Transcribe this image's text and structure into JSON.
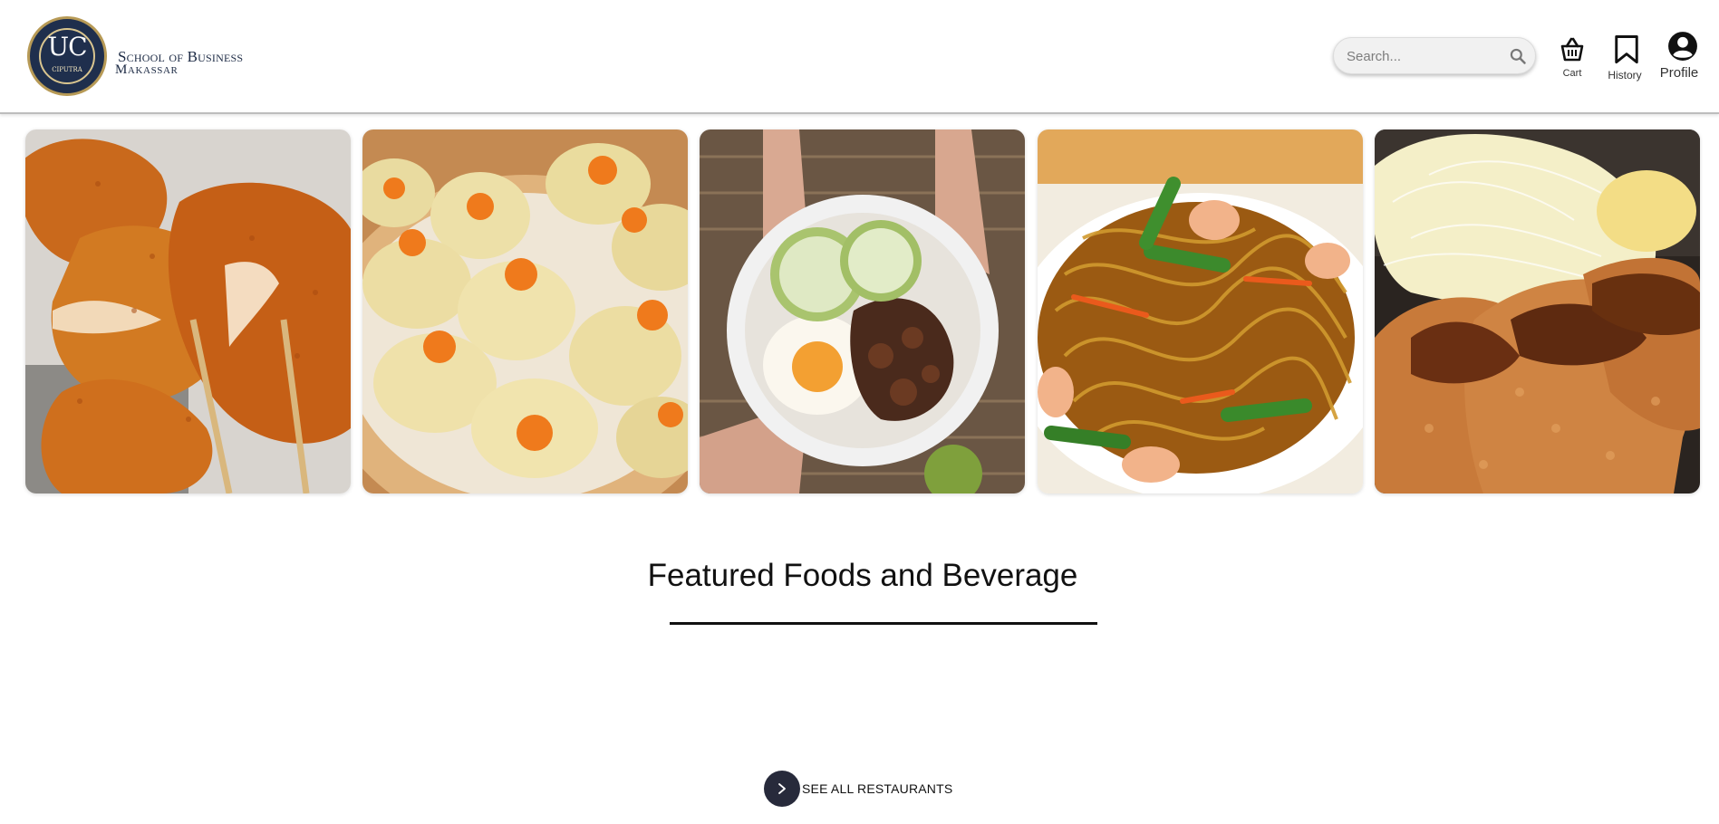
{
  "header": {
    "logo": {
      "seal_text": "UC",
      "seal_subtext": "CIPUTRA",
      "line1": "School of Business",
      "line2": "Makassar"
    },
    "search": {
      "placeholder": "Search..."
    },
    "nav": [
      {
        "label": "Cart",
        "icon": "basket-icon"
      },
      {
        "label": "History",
        "icon": "bookmark-icon"
      },
      {
        "label": "Profile",
        "icon": "user-circle-icon"
      }
    ]
  },
  "gallery": [
    {
      "name": "crispy-fried-chicken"
    },
    {
      "name": "shumai-dumplings"
    },
    {
      "name": "rice-bowl-with-egg-and-cucumber"
    },
    {
      "name": "stir-fried-noodles-with-shrimp"
    },
    {
      "name": "pork-katsu-with-cabbage"
    }
  ],
  "featured": {
    "title": "Featured Foods and Beverage",
    "see_all_label": "SEE ALL RESTAURANTS"
  },
  "colors": {
    "accent_dark": "#272a3b",
    "header_border": "#bdbdbd"
  }
}
